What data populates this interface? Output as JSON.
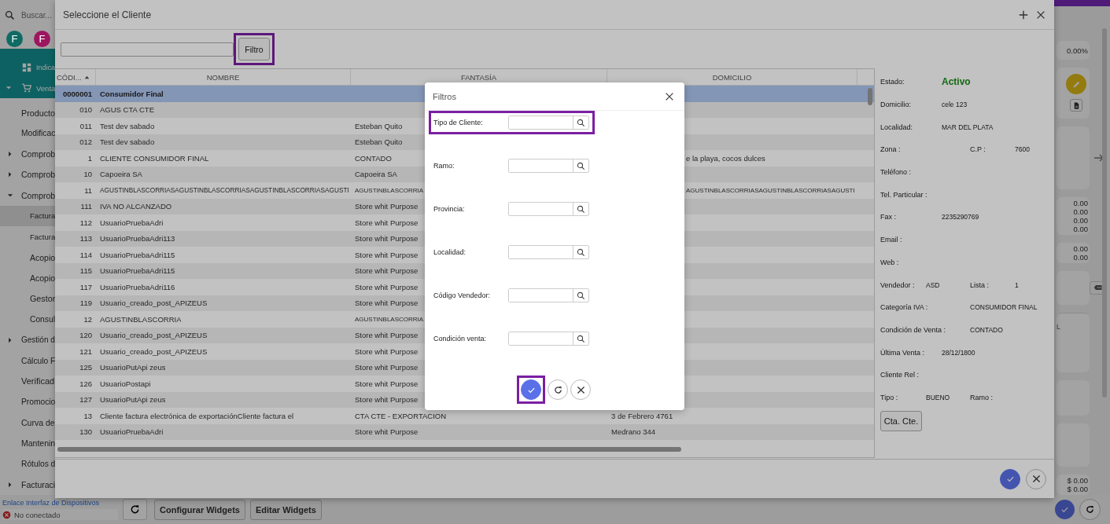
{
  "sidebar": {
    "search": {
      "placeholder": "Buscar..."
    },
    "avatars": [
      {
        "letter": "F",
        "color": "#0f6b64"
      },
      {
        "letter": "F",
        "color": "#9c1660"
      }
    ],
    "items": [
      {
        "label": "Indica",
        "kind": "module",
        "selected": false
      },
      {
        "label": "Venta",
        "kind": "module",
        "selected": false,
        "expanded": true,
        "children": [
          {
            "label": "Producto",
            "selected": false
          },
          {
            "label": "Modificac",
            "selected": false
          },
          {
            "label": "Comprob",
            "selected": false,
            "expanded": false
          },
          {
            "label": "Comprob",
            "selected": false,
            "expanded": false
          },
          {
            "label": "Comprob",
            "selected": false,
            "expanded": true,
            "children": [
              {
                "label": "Factura",
                "selected": true
              },
              {
                "label": "Factura",
                "selected": false
              },
              {
                "label": "Acopio",
                "selected": false
              },
              {
                "label": "Acopio",
                "selected": false
              },
              {
                "label": "Gestor",
                "selected": false
              },
              {
                "label": "Consul",
                "selected": false
              }
            ]
          },
          {
            "label": "Gestión d",
            "selected": false,
            "expanded": false
          },
          {
            "label": "Cálculo F",
            "selected": false
          },
          {
            "label": "Verificad",
            "selected": false
          },
          {
            "label": "Promocio",
            "selected": false
          },
          {
            "label": "Curva de",
            "selected": false
          },
          {
            "label": "Mantenin",
            "selected": false
          },
          {
            "label": "Rótulos d",
            "selected": false
          },
          {
            "label": "Facturaci",
            "selected": false,
            "expanded": false
          }
        ]
      }
    ]
  },
  "right_strip": {
    "rate": "0.00%",
    "balances": [
      "0.00",
      "0.00",
      "0.00",
      "0.00"
    ],
    "balances_2": [
      "0.00",
      "0.00"
    ],
    "column_header": "L",
    "totals": [
      "$ 0.00",
      "$ 0.00"
    ]
  },
  "bottom_bar": {
    "device_link": "Enlace Interfaz de Dispositivos",
    "device_status": "No conectado",
    "buttons": [
      "Configurar Widgets",
      "Editar Widgets"
    ]
  },
  "client_dialog": {
    "title": "Seleccione el Cliente",
    "filter_button": {
      "label": "Filtro",
      "highlighted": true
    },
    "columns": [
      {
        "label": "CÓDI...",
        "sorted": true
      },
      {
        "label": "NOMBRE",
        "sorted": false
      },
      {
        "label": "FANTASÍA",
        "sorted": false
      },
      {
        "label": "DOMICILIO",
        "sorted": false
      }
    ],
    "rows": [
      {
        "code": "0000001",
        "name": "Consumidor Final",
        "selected": true
      },
      {
        "code": "010",
        "name": "AGUS CTA CTE",
        "selected": false
      },
      {
        "code": "011",
        "name": "Test dev sabado",
        "fantasia": "Esteban Quito",
        "selected": false
      },
      {
        "code": "012",
        "name": "Test dev sabado",
        "fantasia": "Esteban Quito",
        "selected": false
      },
      {
        "code": "1",
        "name": "CLIENTE CONSUMIDOR FINAL",
        "fantasia": "CONTADO",
        "address": "e la playa, cocos dulces",
        "selected": false,
        "covered": true
      },
      {
        "code": "10",
        "name": "Capoeira SA",
        "fantasia": "Capoeira SA",
        "selected": false
      },
      {
        "code": "11",
        "name": "AGUSTINBLASCORRIASAGUSTINBLASCORRIASAGUSTINBLASCORRIASAGUSTI",
        "fantasia": "AGUSTINBLASCORRIA",
        "address": "AGUSTINBLASCORRIASAGUSTINBLASCORRIASAGUSTI",
        "selected": false,
        "covered": true
      },
      {
        "code": "111",
        "name": "IVA NO ALCANZADO",
        "fantasia": "Store whit Purpose",
        "selected": false
      },
      {
        "code": "112",
        "name": "UsuarioPruebaAdri",
        "fantasia": "Store whit Purpose",
        "selected": false
      },
      {
        "code": "113",
        "name": "UsuarioPruebaAdri113",
        "fantasia": "Store whit Purpose",
        "selected": false
      },
      {
        "code": "114",
        "name": "UsuarioPruebaAdri115",
        "fantasia": "Store whit Purpose",
        "selected": false
      },
      {
        "code": "115",
        "name": "UsuarioPruebaAdri115",
        "fantasia": "Store whit Purpose",
        "selected": false
      },
      {
        "code": "117",
        "name": "UsuarioPruebaAdri116",
        "fantasia": "Store whit Purpose",
        "selected": false
      },
      {
        "code": "119",
        "name": "Usuario_creado_post_APIZEUS",
        "fantasia": "Store whit Purpose",
        "selected": false
      },
      {
        "code": "12",
        "name": "AGUSTINBLASCORRIA",
        "fantasia": "AGUSTINBLASCORRIA",
        "selected": false,
        "covered": true
      },
      {
        "code": "120",
        "name": "Usuario_creado_post_APIZEUS",
        "fantasia": "Store whit Purpose",
        "selected": false
      },
      {
        "code": "121",
        "name": "Usuario_creado_post_APIZEUS",
        "fantasia": "Store whit Purpose",
        "selected": false
      },
      {
        "code": "125",
        "name": "UsuarioPutApi zeus",
        "fantasia": "Store whit Purpose",
        "selected": false
      },
      {
        "code": "126",
        "name": "UsuarioPostapi",
        "fantasia": "Store whit Purpose",
        "selected": false
      },
      {
        "code": "127",
        "name": "UsuarioPutApi zeus",
        "fantasia": "Store whit Purpose",
        "selected": false
      },
      {
        "code": "13",
        "name": "Cliente factura electrónica de exportaciónCliente factura el",
        "fantasia": "CTA CTE - EXPORTACION",
        "address": "3 de Febrero 4761",
        "selected": false
      },
      {
        "code": "130",
        "name": "UsuarioPruebaAdri",
        "fantasia": "Store whit Purpose",
        "address": "Medrano 344",
        "selected": false
      }
    ],
    "details": [
      {
        "kind": "status",
        "fields": [
          {
            "label": "Estado:",
            "value": "Activo"
          }
        ]
      },
      {
        "kind": "single",
        "fields": [
          {
            "label": "Domicilio:",
            "value": "cele 123"
          }
        ]
      },
      {
        "kind": "single",
        "fields": [
          {
            "label": "Localidad:",
            "value": "MAR DEL PLATA"
          }
        ]
      },
      {
        "kind": "pair",
        "fields": [
          {
            "label": "Zona :"
          },
          {
            "label": "C.P :",
            "value": "7600"
          }
        ]
      },
      {
        "kind": "single",
        "fields": [
          {
            "label": "Teléfono :"
          }
        ]
      },
      {
        "kind": "single",
        "fields": [
          {
            "label": "Tel. Particular :"
          }
        ]
      },
      {
        "kind": "single",
        "fields": [
          {
            "label": "Fax :",
            "value": "2235290769"
          }
        ]
      },
      {
        "kind": "single",
        "fields": [
          {
            "label": "Email :"
          }
        ]
      },
      {
        "kind": "single",
        "fields": [
          {
            "label": "Web :"
          }
        ]
      },
      {
        "kind": "pair",
        "fields": [
          {
            "label": "Vendedor :",
            "value": "ASD"
          },
          {
            "label": "Lista :",
            "value": "1"
          }
        ]
      },
      {
        "kind": "long",
        "fields": [
          {
            "label": "Categoría IVA :",
            "value": "CONSUMIDOR FINAL"
          }
        ]
      },
      {
        "kind": "long",
        "fields": [
          {
            "label": "Condición de Venta :",
            "value": "CONTADO"
          }
        ]
      },
      {
        "kind": "single",
        "fields": [
          {
            "label": "Última Venta :",
            "value": "28/12/1800"
          }
        ]
      },
      {
        "kind": "single",
        "fields": [
          {
            "label": "Cliente Rel :"
          }
        ]
      },
      {
        "kind": "pair",
        "fields": [
          {
            "label": "Tipo :",
            "value": "BUENO"
          },
          {
            "label": "Ramo :"
          }
        ]
      }
    ],
    "account_button": "Cta. Cte."
  },
  "filters_dialog": {
    "title": "Filtros",
    "fields": [
      {
        "label": "Tipo de Cliente:",
        "highlighted": true
      },
      {
        "label": "Ramo:",
        "highlighted": false
      },
      {
        "label": "Provincia:",
        "highlighted": false
      },
      {
        "label": "Localidad:",
        "highlighted": false
      },
      {
        "label": "Código Vendedor:",
        "highlighted": false
      },
      {
        "label": "Condición venta:",
        "highlighted": false
      }
    ],
    "confirm_highlighted": true
  }
}
